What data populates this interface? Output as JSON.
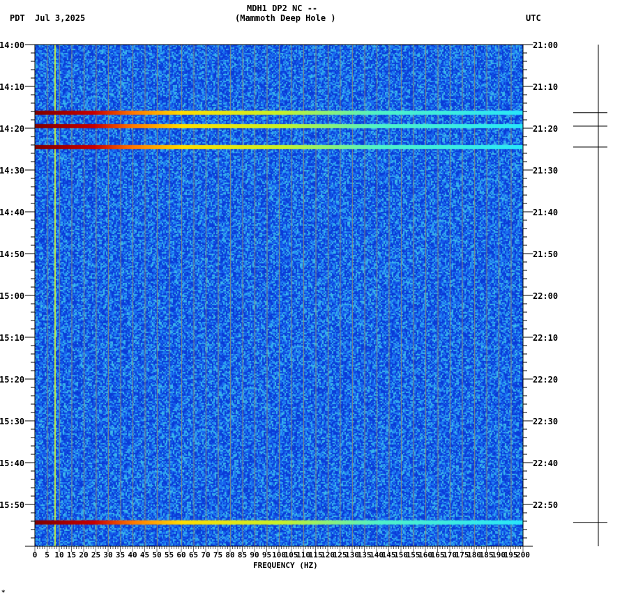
{
  "header": {
    "left_tz": "PDT",
    "date": "Jul 3,2025",
    "title": "MDH1 DP2 NC --",
    "subtitle": "(Mammoth Deep Hole )",
    "right_tz": "UTC"
  },
  "footer_mark": "*",
  "chart_data": {
    "type": "heatmap",
    "title": "MDH1 DP2 NC --",
    "subtitle": "(Mammoth Deep Hole )",
    "xlabel": "FREQUENCY (HZ)",
    "xlim": [
      0,
      200
    ],
    "x_ticks": [
      "0",
      "5",
      "10",
      "15",
      "20",
      "25",
      "30",
      "35",
      "40",
      "45",
      "50",
      "55",
      "60",
      "65",
      "70",
      "75",
      "80",
      "85",
      "90",
      "95",
      "100",
      "105",
      "110",
      "115",
      "120",
      "125",
      "130",
      "135",
      "140",
      "145",
      "150",
      "155",
      "160",
      "165",
      "170",
      "175",
      "180",
      "185",
      "190",
      "195",
      "200"
    ],
    "y_range_minutes": [
      0,
      120
    ],
    "y_ticks_left": [
      "14:00",
      "14:10",
      "14:20",
      "14:30",
      "14:40",
      "14:50",
      "15:00",
      "15:10",
      "15:20",
      "15:30",
      "15:40",
      "15:50"
    ],
    "y_ticks_right": [
      "21:00",
      "21:10",
      "21:20",
      "21:30",
      "21:40",
      "21:50",
      "22:00",
      "22:10",
      "22:20",
      "22:30",
      "22:40",
      "22:50"
    ],
    "background_level": "low (blue)",
    "persistent_line_hz": 8,
    "events_minutes": [
      16.3,
      19.5,
      24.5,
      114.3
    ],
    "colors": {
      "low": "#1a6cf0",
      "high": "#800000"
    }
  }
}
